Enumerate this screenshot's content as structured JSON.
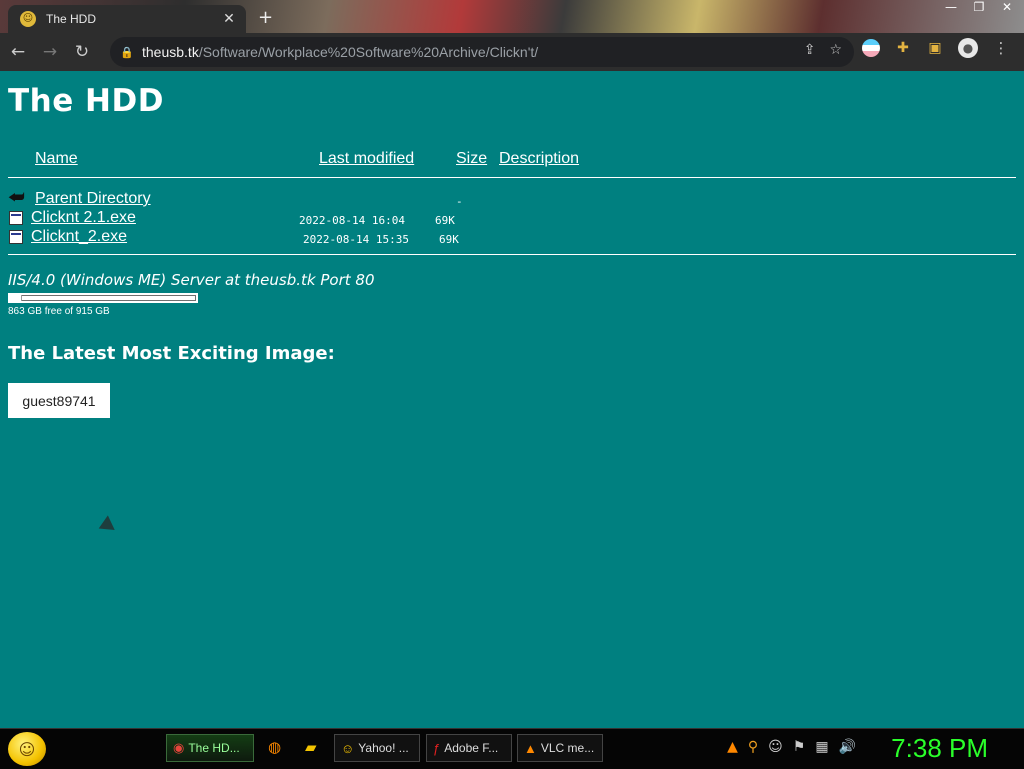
{
  "browser": {
    "tab_title": "The HDD",
    "url_host": "theusb.tk",
    "url_path": "/Software/Workplace%20Software%20Archive/Clickn't/"
  },
  "page": {
    "title": "The HDD",
    "columns": {
      "name": "Name",
      "last_modified": "Last modified",
      "size": "Size",
      "description": "Description"
    },
    "parent": {
      "label": "Parent Directory",
      "size": "-"
    },
    "files": [
      {
        "name": "Clicknt 2.1.exe",
        "date": "2022-08-14 16:04",
        "size": "69K"
      },
      {
        "name": "Clicknt_2.exe",
        "date": "2022-08-14 15:35",
        "size": "69K"
      }
    ],
    "server": "IIS/4.0 (Windows ME) Server at theusb.tk Port 80",
    "disk": {
      "text": "863 GB free of 915 GB",
      "used_fraction": 0.057
    },
    "latest_heading": "The Latest Most Exciting Image:",
    "latest_user": "guest89741"
  },
  "taskbar": {
    "tasks": [
      {
        "label": "The HD...",
        "icon": "chrome-icon"
      },
      {
        "label": "Yahoo! ...",
        "icon": "yahoo-icon"
      },
      {
        "label": "Adobe F...",
        "icon": "flash-icon"
      },
      {
        "label": "VLC me...",
        "icon": "vlc-icon"
      }
    ],
    "clock": "7:38 PM"
  },
  "colors": {
    "page_bg": "#008080",
    "chrome_bg": "#2d2d2d",
    "clock": "#2aff2a"
  }
}
